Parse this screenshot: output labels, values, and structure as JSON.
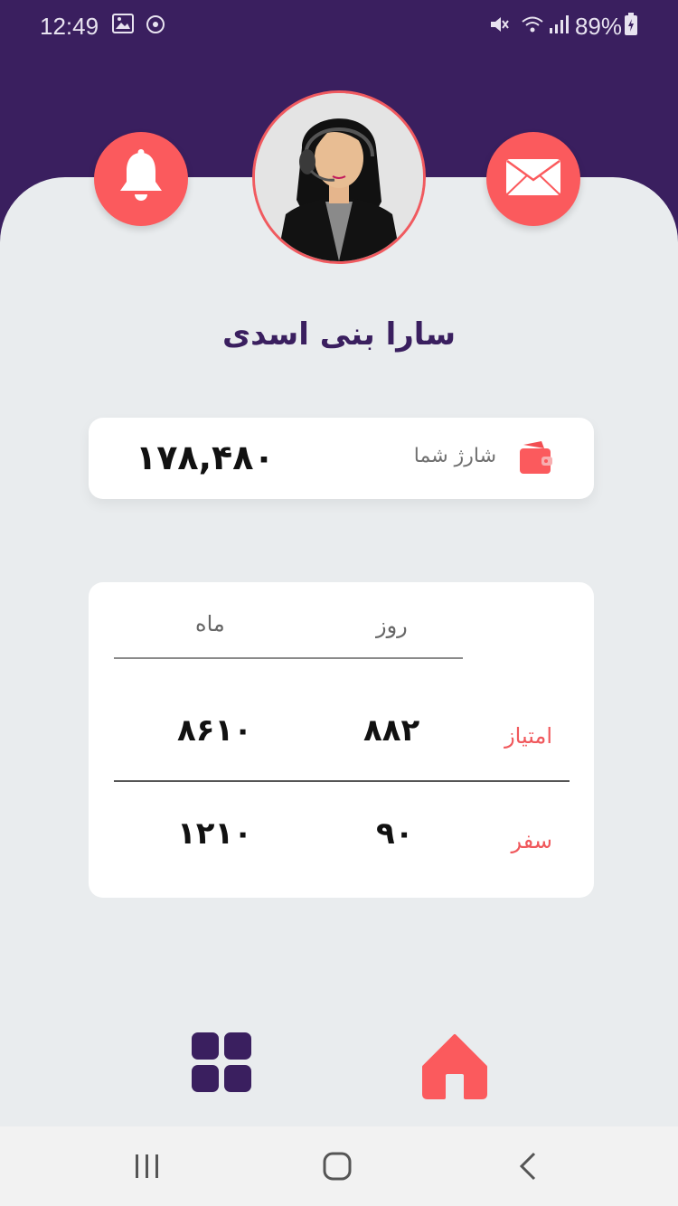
{
  "status_bar": {
    "time": "12:49",
    "battery": "89%"
  },
  "header": {
    "notification_icon": "bell-icon",
    "message_icon": "mail-icon",
    "avatar_icon": "support-agent-avatar"
  },
  "profile": {
    "name": "سارا بنی اسدی"
  },
  "balance": {
    "label": "شارژ شما",
    "amount": "۱۷۸,۴۸۰",
    "icon": "wallet-icon"
  },
  "stats": {
    "columns": [
      "روز",
      "ماه"
    ],
    "rows": [
      {
        "label": "امتیاز",
        "day": "۸۸۲",
        "month": "۸۶۱۰"
      },
      {
        "label": "سفر",
        "day": "۹۰",
        "month": "۱۲۱۰"
      }
    ]
  },
  "tab_bar": {
    "items": [
      {
        "icon": "home-icon",
        "active": true
      },
      {
        "icon": "grid-icon",
        "active": false
      }
    ]
  },
  "colors": {
    "primary_purple": "#3a1f5f",
    "accent_red": "#fb5a5d",
    "background": "#e9ecee"
  }
}
